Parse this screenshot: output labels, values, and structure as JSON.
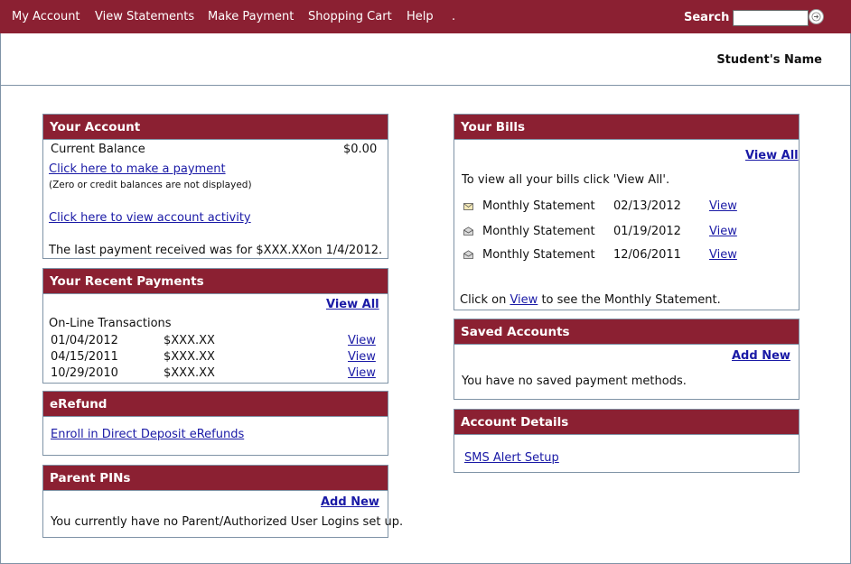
{
  "nav": {
    "items": [
      "My Account",
      "View Statements",
      "Make Payment",
      "Shopping Cart",
      "Help",
      "."
    ],
    "search_label": "Search",
    "search_value": ""
  },
  "header": {
    "student_name": "Student's Name"
  },
  "your_account": {
    "title": "Your Account",
    "balance_label": "Current Balance",
    "balance_value": "$0.00",
    "make_payment_link": "Click here to make a payment",
    "note": "(Zero or credit balances are not displayed)",
    "activity_link": "Click here to view account activity",
    "last_payment_prefix": "The last payment received was for",
    "last_payment_amount": "$XXX.XX",
    "last_payment_suffix": "on 1/4/2012."
  },
  "recent_payments": {
    "title": "Your Recent Payments",
    "view_all": "View All",
    "subtitle": "On-Line Transactions",
    "rows": [
      {
        "date": "01/04/2012",
        "amount": "$XXX.XX",
        "action": "View"
      },
      {
        "date": "04/15/2011",
        "amount": "$XXX.XX",
        "action": "View"
      },
      {
        "date": "10/29/2010",
        "amount": "$XXX.XX",
        "action": "View"
      }
    ]
  },
  "erefund": {
    "title": "eRefund",
    "enroll_link": "Enroll in Direct Deposit eRefunds"
  },
  "parent_pins": {
    "title": "Parent PINs",
    "add_new": "Add New",
    "message": "You currently have no Parent/Authorized User Logins set up."
  },
  "your_bills": {
    "title": "Your Bills",
    "view_all": "View All",
    "intro": "To view all your bills click 'View All'.",
    "rows": [
      {
        "icon": "envelope-closed-icon",
        "name": "Monthly Statement",
        "date": "02/13/2012",
        "action": "View"
      },
      {
        "icon": "envelope-open-icon",
        "name": "Monthly Statement",
        "date": "01/19/2012",
        "action": "View"
      },
      {
        "icon": "envelope-open-icon",
        "name": "Monthly Statement",
        "date": "12/06/2011",
        "action": "View"
      }
    ],
    "footer_prefix": "Click on",
    "footer_link": "View",
    "footer_suffix": "to see the Monthly Statement."
  },
  "saved_accounts": {
    "title": "Saved Accounts",
    "add_new": "Add New",
    "message": "You have no saved payment methods."
  },
  "account_details": {
    "title": "Account Details",
    "sms_link": "SMS Alert Setup"
  },
  "colors": {
    "brand": "#8b2032",
    "link": "#1a1aa6",
    "border": "#7f93a6"
  }
}
